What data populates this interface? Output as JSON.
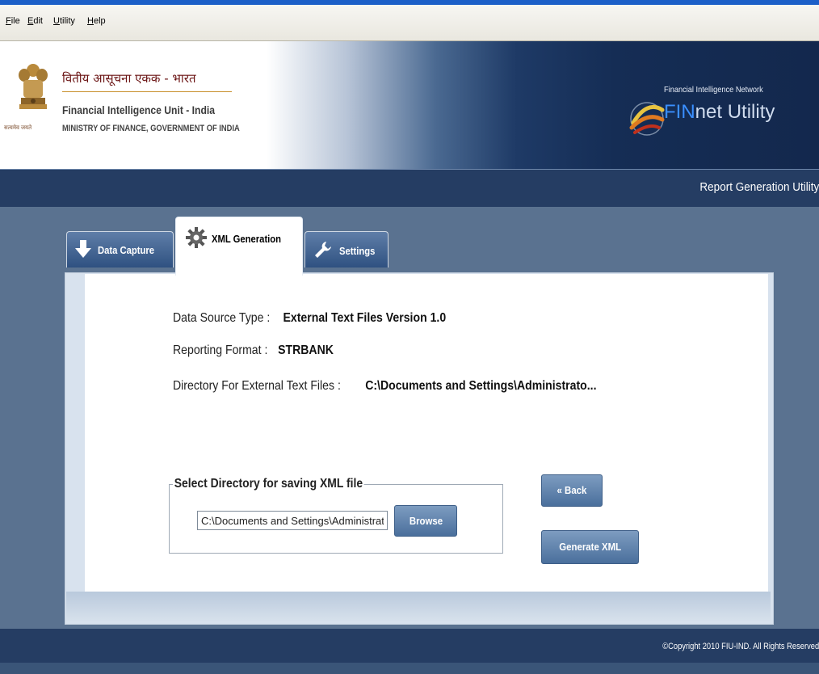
{
  "menu": [
    {
      "hot": "F",
      "rest": "ile"
    },
    {
      "hot": "E",
      "rest": "dit"
    },
    {
      "hot": "U",
      "rest": "tility"
    },
    {
      "hot": "H",
      "rest": "elp"
    }
  ],
  "header": {
    "hindi_title": "वितीय आसूचना एकक - भारत",
    "org_name": "Financial Intelligence Unit - India",
    "ministry": "MINISTRY OF FINANCE, GOVERNMENT OF INDIA",
    "emblem_caption": "सत्यमेव जयते",
    "network_subtitle": "Financial Intelligence Network",
    "product_fin": "FIN",
    "product_net": "net",
    "product_utility": " Utility"
  },
  "titlebar": {
    "text": "Report Generation Utility"
  },
  "tabs": [
    {
      "label": "Data Capture",
      "icon": "down-arrow-icon"
    },
    {
      "label": "XML Generation",
      "icon": "gear-icon",
      "active": true
    },
    {
      "label": "Settings",
      "icon": "wrench-icon"
    }
  ],
  "info": {
    "data_source_label": "Data Source Type :",
    "data_source_value": "External Text Files Version 1.0",
    "reporting_format_label": "Reporting Format :",
    "reporting_format_value": "STRBANK",
    "directory_label": "Directory For External Text Files :",
    "directory_value": "C:\\Documents and Settings\\Administrato..."
  },
  "save_section": {
    "legend": "Select Directory for saving XML file",
    "path_value": "C:\\Documents and Settings\\Administrator",
    "browse_label": "Browse"
  },
  "actions": {
    "back_label": "« Back",
    "generate_label": "Generate XML"
  },
  "footer": {
    "copyright": "©Copyright 2010 FIU-IND. All Rights Reserved"
  },
  "colors": {
    "accent_blue": "#3a8fff",
    "navy": "#253d63",
    "button": "#5a7ea8"
  }
}
